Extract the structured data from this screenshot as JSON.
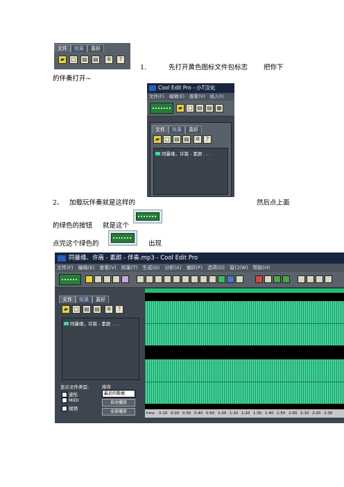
{
  "doc": {
    "step1_number": "1.",
    "step1_text_a": "先打开黄色图标文件包标志",
    "step1_text_b": "把你下",
    "step1_text_c": "的伴奏打开~",
    "step2_number": "2、",
    "step2_text_a": "加载玩伴奏就是这样的",
    "step2_text_b": "然后点上面",
    "step2_text_c": "的绿色的按钮",
    "step2_text_d": "就是这个",
    "step3_text_a": "点完这个绿色的",
    "step3_text_b": "出现"
  },
  "shot1": {
    "tabs": [
      "文件",
      "效果",
      "喜好"
    ]
  },
  "shot2": {
    "title": "Cool Edit Pro - 小T汉化",
    "menu": [
      "文件(F)",
      "编辑(E)",
      "查看(V)",
      "插入(I)"
    ],
    "tabs": [
      "文件",
      "效果",
      "喜好"
    ],
    "file_item": "同曼缘，许嵩 - 素颜 . . ."
  },
  "shot3": {
    "title": "同曼缘、许嵩 - 素颜 - 伴奏.mp3 - Cool Edit Pro",
    "menu": [
      "文件(F)",
      "编辑(E)",
      "查看(V)",
      "效果(T)",
      "生成(G)",
      "分析(A)",
      "偏好(F)",
      "选项(O)",
      "窗口(W)",
      "帮助(H)"
    ],
    "tabs": [
      "文件",
      "效果",
      "喜好"
    ],
    "file_item": "同曼缘，许嵩 - 素颜 . . .",
    "filetype_label": "显示文件类型:",
    "sort_label": "排序",
    "filetypes": [
      "波形",
      "MIDI",
      "视频"
    ],
    "sort_value": "最近的数据",
    "btn_autoplay": "自动播放",
    "btn_full": "全部播放",
    "ruler_label": "hms",
    "ruler_ticks": [
      "0:10",
      "0:20",
      "0:30",
      "0:40",
      "0:50",
      "1:00",
      "1:10",
      "1:20",
      "1:30",
      "1:40",
      "1:50",
      "2:00",
      "2:10",
      "2:20",
      "2:30"
    ]
  }
}
